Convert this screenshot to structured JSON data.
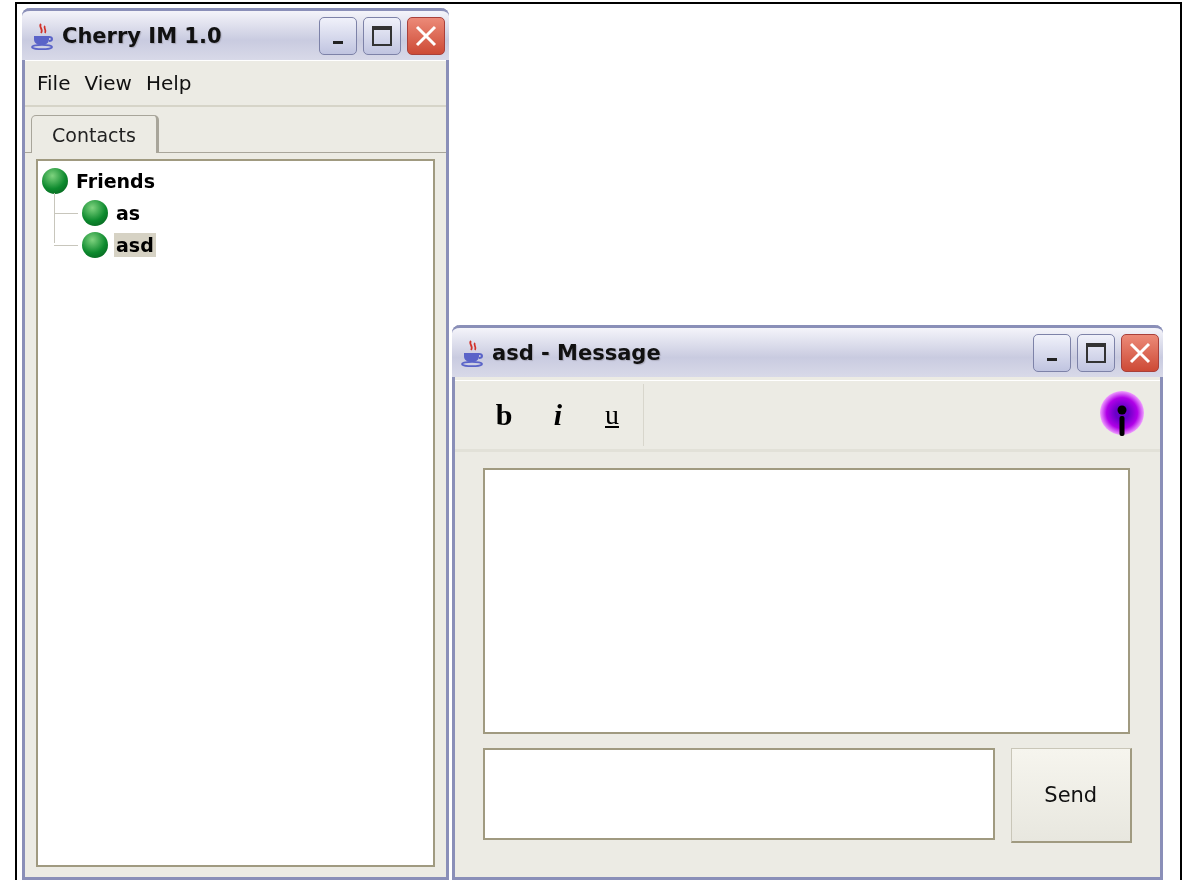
{
  "main_window": {
    "title": "Cherry IM 1.0",
    "menu": [
      "File",
      "View",
      "Help"
    ],
    "tabs": [
      {
        "label": "Contacts",
        "selected": true
      }
    ],
    "tree": [
      {
        "label": "Friends",
        "selected": false,
        "children": [
          {
            "label": "as",
            "selected": false
          },
          {
            "label": "asd",
            "selected": true
          }
        ]
      }
    ]
  },
  "message_window": {
    "title": "asd - Message",
    "format_buttons": [
      {
        "label": "b",
        "kind": "bold"
      },
      {
        "label": "i",
        "kind": "italic"
      },
      {
        "label": "u",
        "kind": "underline"
      }
    ],
    "send_button": "Send"
  }
}
